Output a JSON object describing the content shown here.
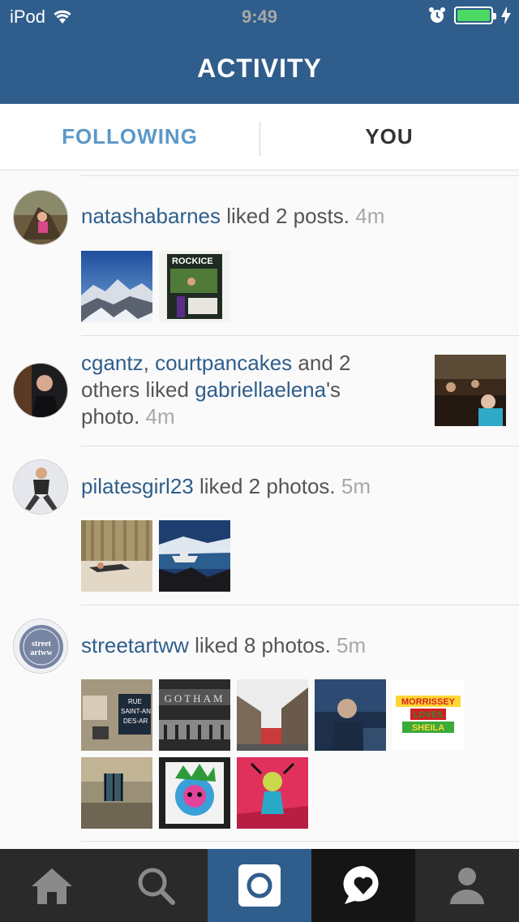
{
  "status_bar": {
    "carrier": "iPod",
    "time": "9:49"
  },
  "header": {
    "title": "ACTIVITY"
  },
  "tabs": [
    {
      "label": "FOLLOWING",
      "active": true
    },
    {
      "label": "YOU",
      "active": false
    }
  ],
  "feed": [
    {
      "user": "natashabarnes",
      "text": " liked 2 posts. ",
      "time": "4m"
    },
    {
      "user1": "cgantz",
      "comma": ", ",
      "user2": "courtpancakes",
      "text1": " and 2",
      "text2": "others liked ",
      "user3": "gabriellaelena",
      "text3": "'s",
      "text4": "photo. ",
      "time": "4m"
    },
    {
      "user": "pilatesgirl23",
      "text": " liked 2 photos. ",
      "time": "5m"
    },
    {
      "user": "streetartww",
      "text": " liked 8 photos. ",
      "time": "5m",
      "avatar_text_1": "street",
      "avatar_text_2": "artww",
      "thumbnail_texts": {
        "rue_1": "RUE",
        "rue_2": "SAINT-AN",
        "rue_3": "DES-AR",
        "gotham": "GOTHAM",
        "rockice": "ROCKICE",
        "morrissey_1": "MORRISSEY",
        "morrissey_2": "LOVES",
        "morrissey_3": "SHEILA"
      }
    }
  ],
  "tabbar": [
    "home-icon",
    "search-icon",
    "camera-icon",
    "activity-heart-icon",
    "profile-icon"
  ],
  "colors": {
    "header_bg": "#2f5e8c",
    "username": "#2f5e8c",
    "active_tab": "#5b98c9",
    "timestamp": "#a8a8a8"
  }
}
